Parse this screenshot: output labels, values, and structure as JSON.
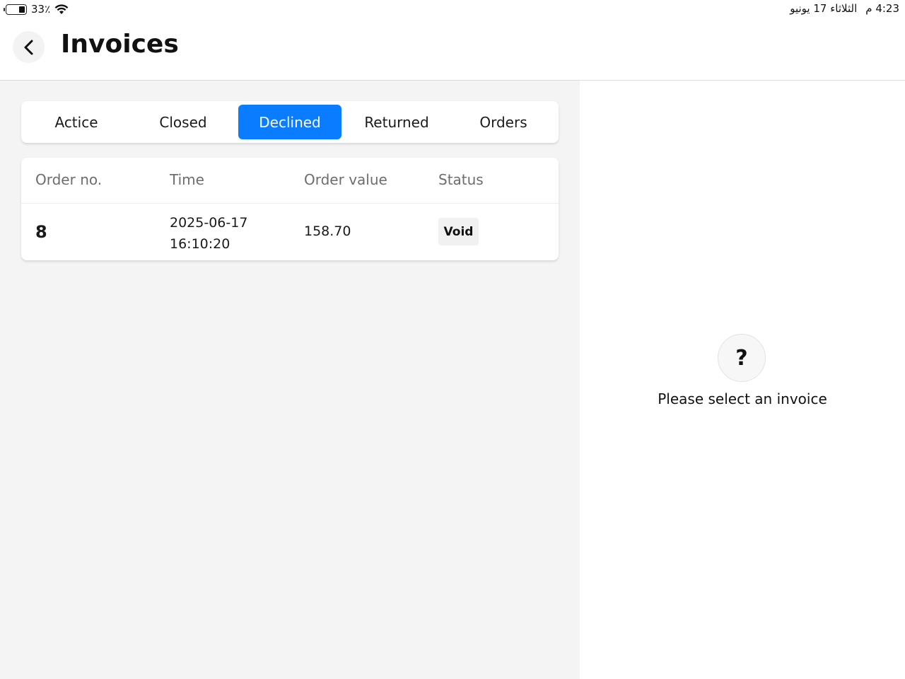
{
  "status_bar": {
    "battery_percent": "33٪",
    "battery_level": 0.33,
    "time": "4:23 م",
    "date": "الثلاثاء 17 يونيو"
  },
  "header": {
    "title": "Invoices",
    "back_icon": "chevron-left-icon"
  },
  "tabs": [
    {
      "label": "Actice",
      "active": false
    },
    {
      "label": "Closed",
      "active": false
    },
    {
      "label": "Declined",
      "active": true
    },
    {
      "label": "Returned",
      "active": false
    },
    {
      "label": "Orders",
      "active": false
    }
  ],
  "table": {
    "headers": [
      "Order no.",
      "Time",
      "Order value",
      "Status"
    ],
    "rows": [
      {
        "order_no": "8",
        "date": "2025-06-17",
        "time": "16:10:20",
        "value": "158.70",
        "status": "Void"
      }
    ]
  },
  "detail": {
    "icon": "question-mark-icon",
    "icon_glyph": "?",
    "message": "Please select an invoice"
  },
  "colors": {
    "accent": "#0a7cff",
    "pane_bg": "#f4f4f4"
  }
}
